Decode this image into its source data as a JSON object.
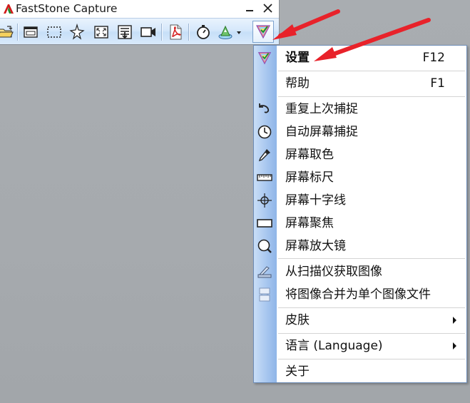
{
  "window": {
    "title": "FastStone Capture",
    "minimize_label": "—",
    "close_label": "✕"
  },
  "toolbar": {
    "buttons": [
      {
        "icon": "open-folder-icon"
      },
      {
        "icon": "capture-window-icon"
      },
      {
        "icon": "capture-rectangle-icon"
      },
      {
        "icon": "capture-freehand-icon"
      },
      {
        "icon": "capture-fullscreen-icon"
      },
      {
        "icon": "capture-scrolling-icon"
      },
      {
        "icon": "screen-recorder-icon"
      },
      {
        "icon": "pdf-icon"
      },
      {
        "icon": "timer-icon"
      },
      {
        "icon": "output-destination-icon"
      },
      {
        "icon": "settings-menu-icon"
      }
    ]
  },
  "menu": {
    "items": [
      {
        "label": "设置",
        "shortcut": "F12",
        "icon": "settings-icon",
        "bold": true
      },
      {
        "label": "帮助",
        "shortcut": "F1"
      },
      {
        "label": "重复上次捕捉",
        "icon": "repeat-arrow-icon"
      },
      {
        "label": "自动屏幕捕捉",
        "icon": "clock-icon"
      },
      {
        "label": "屏幕取色",
        "icon": "eyedropper-icon"
      },
      {
        "label": "屏幕标尺",
        "icon": "ruler-icon"
      },
      {
        "label": "屏幕十字线",
        "icon": "crosshair-icon"
      },
      {
        "label": "屏幕聚焦",
        "icon": "focus-rectangle-icon"
      },
      {
        "label": "屏幕放大镜",
        "icon": "magnifier-icon"
      },
      {
        "label": "从扫描仪获取图像",
        "icon": "scanner-icon"
      },
      {
        "label": "将图像合并为单个图像文件",
        "icon": "merge-images-icon"
      },
      {
        "label": "皮肤",
        "submenu": true
      },
      {
        "label": "语言 (Language)",
        "submenu": true
      },
      {
        "label": "关于"
      }
    ]
  },
  "colors": {
    "annotation_arrow": "#e8222a",
    "menu_gutter": "#a8c7ef",
    "toolbar_bg": "#d6e8fb"
  }
}
